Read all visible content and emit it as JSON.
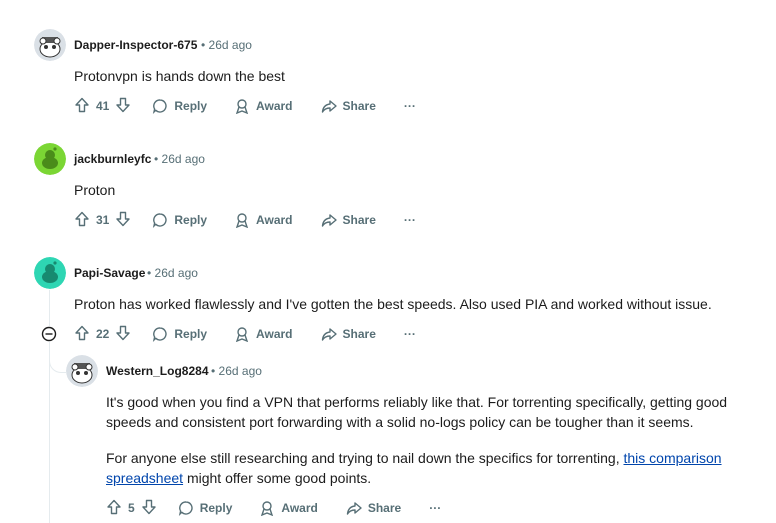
{
  "comments": [
    {
      "author": "Dapper-Inspector-675",
      "separator": "•",
      "time": "26d ago",
      "body": "Protonvpn is hands down the best",
      "votes": "41",
      "reply_label": "Reply",
      "award_label": "Award",
      "share_label": "Share",
      "more_label": "···",
      "avatar_color": "#dae0e6"
    },
    {
      "author": "jackburnleyfc",
      "separator": "•",
      "time": "26d ago",
      "body": "Proton",
      "votes": "31",
      "reply_label": "Reply",
      "award_label": "Award",
      "share_label": "Share",
      "more_label": "···",
      "avatar_color": "#7bd634"
    },
    {
      "author": "Papi-Savage",
      "separator": "•",
      "time": "26d ago",
      "body": "Proton has worked flawlessly and I've gotten the best speeds. Also used PIA and worked without issue.",
      "votes": "22",
      "reply_label": "Reply",
      "award_label": "Award",
      "share_label": "Share",
      "more_label": "···",
      "avatar_color": "#2ed6b3"
    }
  ],
  "reply": {
    "author": "Western_Log8284",
    "separator": "•",
    "time": "26d ago",
    "paragraph1": "It's good when you find a VPN that performs reliably like that. For torrenting specifically, getting good speeds and consistent port forwarding with a solid no-logs policy can be tougher than it seems.",
    "paragraph2_before": "For anyone else still researching and trying to nail down the specifics for torrenting, ",
    "link_text": "this comparison spreadsheet",
    "paragraph2_after": " might offer some good points.",
    "votes": "5",
    "reply_label": "Reply",
    "award_label": "Award",
    "share_label": "Share",
    "more_label": "···",
    "avatar_color": "#dae0e6"
  },
  "colors": {
    "meta": "#576f76",
    "link": "#0045ac",
    "thread_line": "#e5ebee"
  }
}
